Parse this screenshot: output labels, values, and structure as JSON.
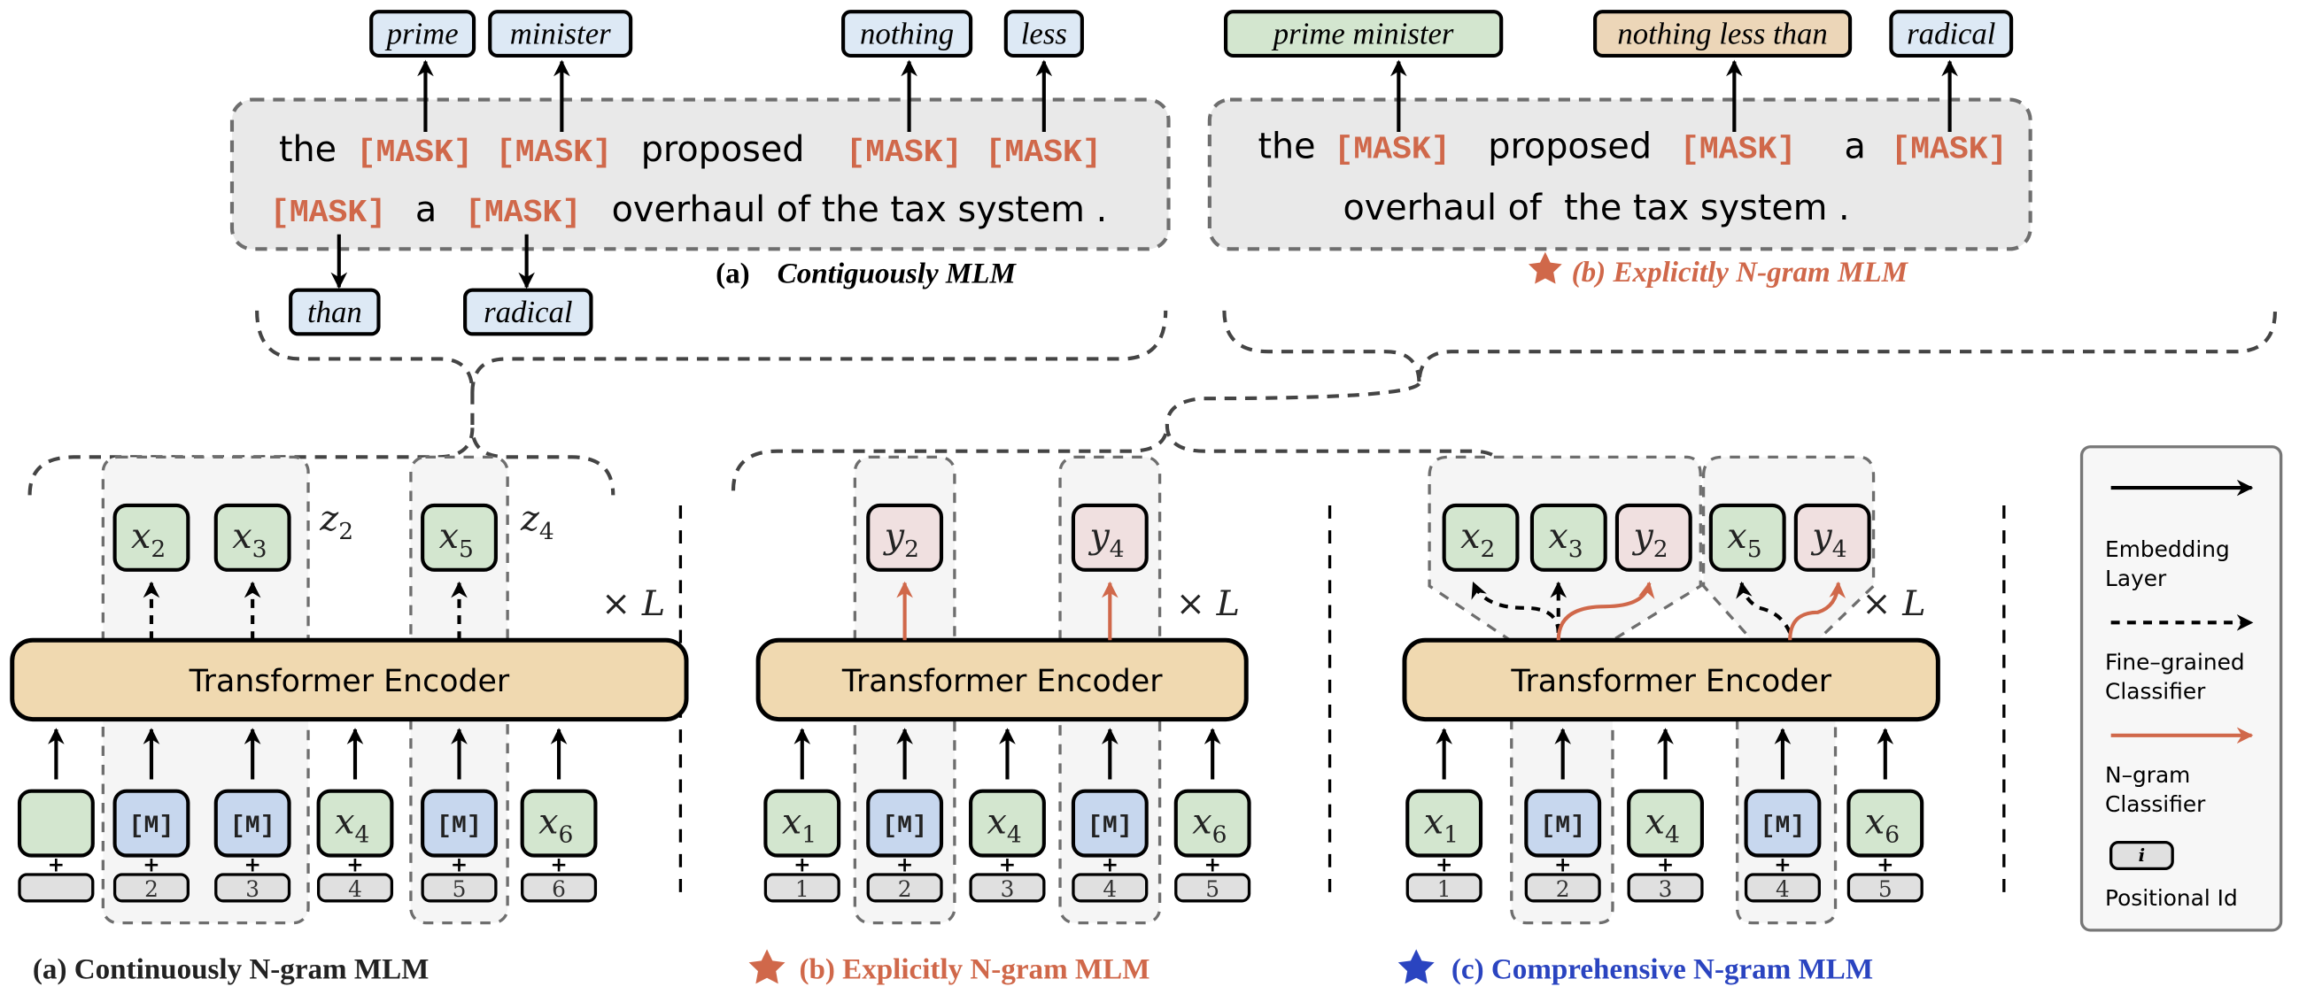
{
  "colors": {
    "mask_text": "#d0684a",
    "token_green": "#d3e6cf",
    "mask_blue": "#c7d7ee",
    "ngram_pink": "#f0e0e0",
    "label_blue": "#dde9f5",
    "label_orange": "#ecd6b8",
    "encoder": "#f0d9b0",
    "pos_gray": "#e0e0e0",
    "accent_orange": "#d0684a",
    "accent_blue": "#2a44c0"
  },
  "top_a": {
    "line1": [
      "the",
      "[MASK]",
      "[MASK]",
      "proposed",
      "[MASK]",
      "[MASK]"
    ],
    "line2": [
      "[MASK]",
      "a",
      "[MASK]",
      "overhaul of the tax system ."
    ],
    "labels_above": [
      "prime",
      "minister",
      "nothing",
      "less"
    ],
    "labels_below": [
      "than",
      "radical"
    ],
    "caption_prefix": "(a)",
    "caption": "Contiguously MLM"
  },
  "top_b": {
    "line1": [
      "the",
      "[MASK]",
      "proposed",
      "[MASK]",
      "a",
      "[MASK]"
    ],
    "line2": [
      "overhaul of  the tax system ."
    ],
    "labels_above": [
      "prime minister",
      "nothing less than",
      "radical"
    ],
    "caption": "(b) Explicitly N-gram MLM",
    "star_icon": "star"
  },
  "panels": {
    "a": {
      "encoder": "Transformer Encoder",
      "inputs": [
        {
          "type": "token",
          "sym": "",
          "sub": ""
        },
        {
          "type": "mask",
          "sym": "[M]",
          "sub": ""
        },
        {
          "type": "mask",
          "sym": "[M]",
          "sub": ""
        },
        {
          "type": "token",
          "sym": "x",
          "sub": "4"
        },
        {
          "type": "mask",
          "sym": "[M]",
          "sub": ""
        },
        {
          "type": "token",
          "sym": "x",
          "sub": "6"
        }
      ],
      "positions": [
        "",
        "2",
        "3",
        "4",
        "5",
        "6"
      ],
      "outputs": [
        {
          "type": "token",
          "sym": "x",
          "sub": "2"
        },
        {
          "type": "token",
          "sym": "x",
          "sub": "3"
        },
        {
          "type": "token",
          "sym": "x",
          "sub": "5"
        }
      ],
      "group_labels": [
        {
          "sym": "z",
          "sub": "2"
        },
        {
          "sym": "z",
          "sub": "4"
        }
      ],
      "repeat": "× L",
      "caption": "(a)  Continuously N-gram MLM"
    },
    "b": {
      "encoder": "Transformer Encoder",
      "inputs": [
        {
          "type": "token",
          "sym": "x",
          "sub": "1"
        },
        {
          "type": "mask",
          "sym": "[M]",
          "sub": ""
        },
        {
          "type": "token",
          "sym": "x",
          "sub": "4"
        },
        {
          "type": "mask",
          "sym": "[M]",
          "sub": ""
        },
        {
          "type": "token",
          "sym": "x",
          "sub": "6"
        }
      ],
      "positions": [
        "1",
        "2",
        "3",
        "4",
        "5"
      ],
      "outputs": [
        {
          "type": "ngram",
          "sym": "y",
          "sub": "2"
        },
        {
          "type": "ngram",
          "sym": "y",
          "sub": "4"
        }
      ],
      "repeat": "× L",
      "caption": "(b) Explicitly N-gram MLM",
      "star_icon": "star"
    },
    "c": {
      "encoder": "Transformer Encoder",
      "inputs": [
        {
          "type": "token",
          "sym": "x",
          "sub": "1"
        },
        {
          "type": "mask",
          "sym": "[M]",
          "sub": ""
        },
        {
          "type": "token",
          "sym": "x",
          "sub": "4"
        },
        {
          "type": "mask",
          "sym": "[M]",
          "sub": ""
        },
        {
          "type": "token",
          "sym": "x",
          "sub": "6"
        }
      ],
      "positions": [
        "1",
        "2",
        "3",
        "4",
        "5"
      ],
      "outputs": [
        {
          "type": "token",
          "sym": "x",
          "sub": "2"
        },
        {
          "type": "token",
          "sym": "x",
          "sub": "3"
        },
        {
          "type": "ngram",
          "sym": "y",
          "sub": "2"
        },
        {
          "type": "token",
          "sym": "x",
          "sub": "5"
        },
        {
          "type": "ngram",
          "sym": "y",
          "sub": "4"
        }
      ],
      "repeat": "× L",
      "caption": "(c) Comprehensive N-gram MLM",
      "star_icon": "star"
    }
  },
  "legend": {
    "items": [
      {
        "icon": "solid-arrow",
        "line1": "Embedding",
        "line2": "Layer"
      },
      {
        "icon": "dashed-arrow",
        "line1": "Fine–grained",
        "line2": "Classifier"
      },
      {
        "icon": "orange-arrow",
        "line1": "N–gram",
        "line2": "Classifier"
      },
      {
        "icon": "positional-box",
        "symbol": "i",
        "line1": "Positional Id",
        "line2": ""
      }
    ]
  }
}
